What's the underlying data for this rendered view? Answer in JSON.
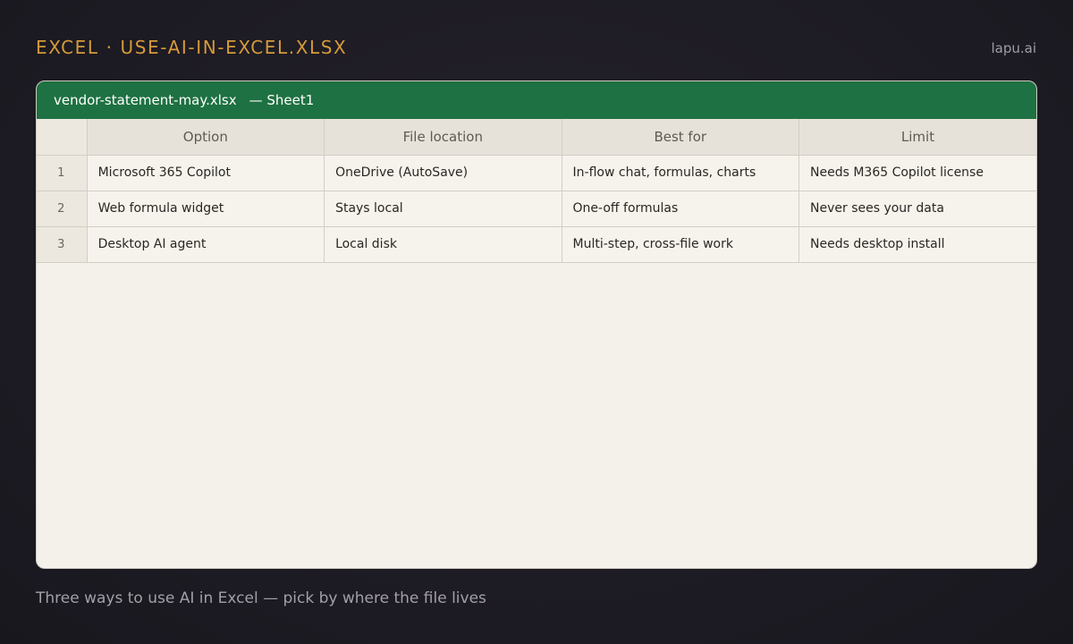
{
  "header": {
    "title": "EXCEL · USE-AI-IN-EXCEL.XLSX",
    "brand": "lapu.ai"
  },
  "window": {
    "file_name": "vendor-statement-may.xlsx",
    "sheet_name": "— Sheet1"
  },
  "table": {
    "columns": [
      "Option",
      "File location",
      "Best for",
      "Limit"
    ],
    "rows": [
      {
        "num": "1",
        "cells": [
          "Microsoft 365 Copilot",
          "OneDrive (AutoSave)",
          "In-flow chat, formulas, charts",
          "Needs M365 Copilot license"
        ]
      },
      {
        "num": "2",
        "cells": [
          "Web formula widget",
          "Stays local",
          "One-off formulas",
          "Never sees your data"
        ]
      },
      {
        "num": "3",
        "cells": [
          "Desktop AI agent",
          "Local disk",
          "Multi-step, cross-file work",
          "Needs desktop install"
        ]
      }
    ]
  },
  "caption": "Three ways to use AI in Excel — pick by where the file lives",
  "colors": {
    "accent": "#d59a3a",
    "titlebar": "#1e7142",
    "background": "#1f1c26"
  }
}
